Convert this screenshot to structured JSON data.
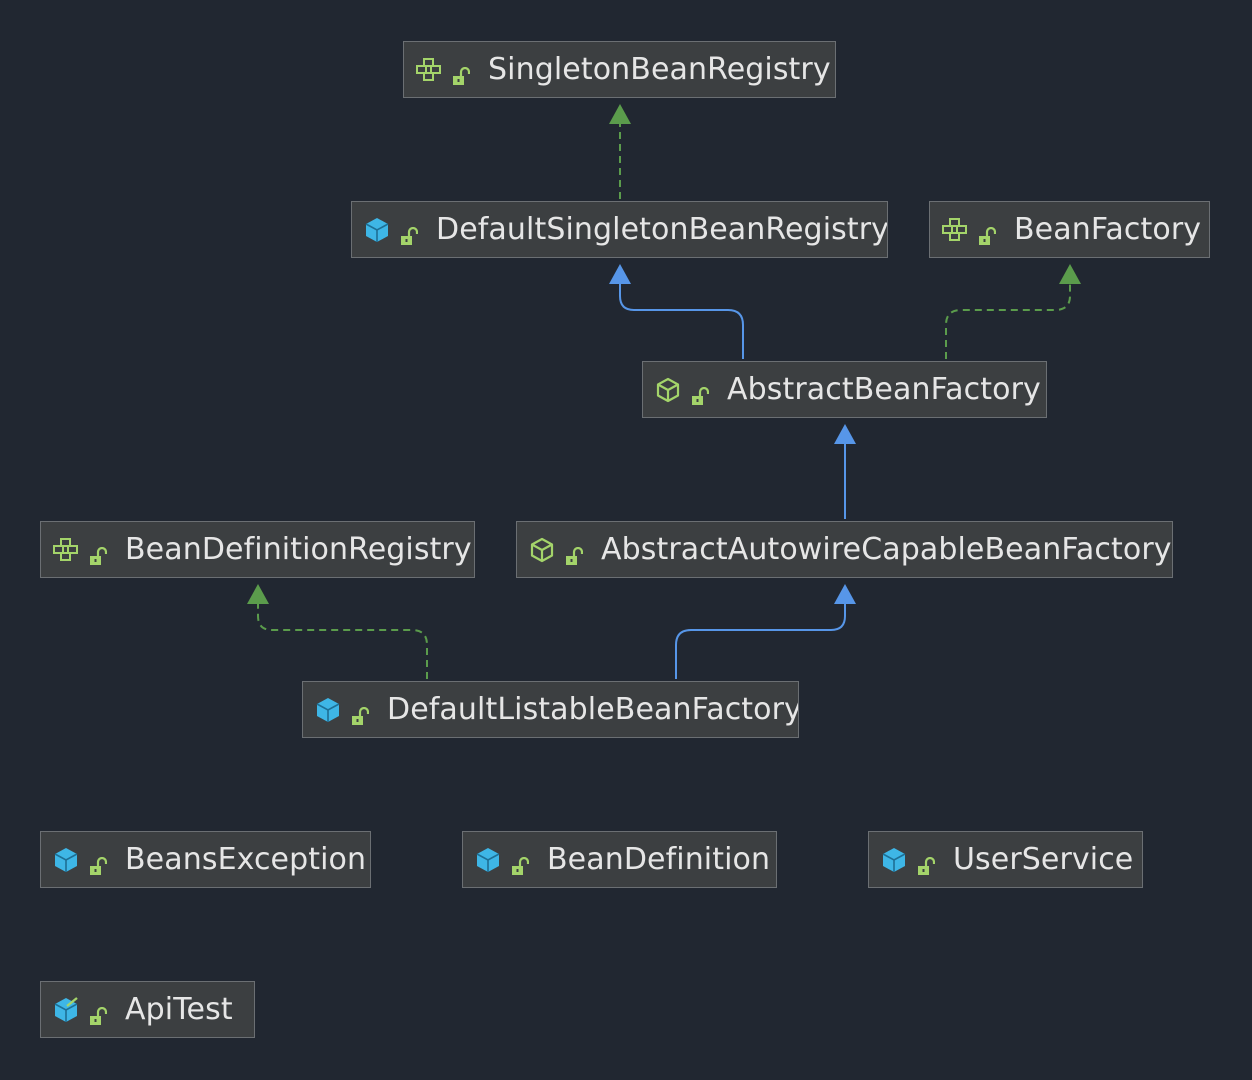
{
  "diagram": {
    "colors": {
      "background": "#212731",
      "node_fill": "#3c3f41",
      "node_border": "#6b6f73",
      "node_text": "#e6e6e6",
      "extends_arrow": "#5796e8",
      "implements_arrow": "#5b9c4c",
      "class_icon": "#3eb6e6",
      "abstract_interface_icon": "#a4d46a",
      "public_icon": "#a4d46a"
    },
    "nodes": [
      {
        "id": "SingletonBeanRegistry",
        "label": "SingletonBeanRegistry",
        "kind": "interface",
        "visibility": "public"
      },
      {
        "id": "DefaultSingletonBeanRegistry",
        "label": "DefaultSingletonBeanRegistry",
        "kind": "class",
        "visibility": "public"
      },
      {
        "id": "BeanFactory",
        "label": "BeanFactory",
        "kind": "interface",
        "visibility": "public"
      },
      {
        "id": "AbstractBeanFactory",
        "label": "AbstractBeanFactory",
        "kind": "abstract-class",
        "visibility": "public"
      },
      {
        "id": "BeanDefinitionRegistry",
        "label": "BeanDefinitionRegistry",
        "kind": "interface",
        "visibility": "public"
      },
      {
        "id": "AbstractAutowireCapableBeanFactory",
        "label": "AbstractAutowireCapableBeanFactory",
        "kind": "abstract-class",
        "visibility": "public"
      },
      {
        "id": "DefaultListableBeanFactory",
        "label": "DefaultListableBeanFactory",
        "kind": "class",
        "visibility": "public"
      },
      {
        "id": "BeansException",
        "label": "BeansException",
        "kind": "class",
        "visibility": "public"
      },
      {
        "id": "BeanDefinition",
        "label": "BeanDefinition",
        "kind": "class",
        "visibility": "public"
      },
      {
        "id": "UserService",
        "label": "UserService",
        "kind": "class",
        "visibility": "public"
      },
      {
        "id": "ApiTest",
        "label": "ApiTest",
        "kind": "test-class",
        "visibility": "public"
      }
    ],
    "edges": [
      {
        "from": "DefaultSingletonBeanRegistry",
        "to": "SingletonBeanRegistry",
        "type": "implements"
      },
      {
        "from": "AbstractBeanFactory",
        "to": "DefaultSingletonBeanRegistry",
        "type": "extends"
      },
      {
        "from": "AbstractBeanFactory",
        "to": "BeanFactory",
        "type": "implements"
      },
      {
        "from": "AbstractAutowireCapableBeanFactory",
        "to": "AbstractBeanFactory",
        "type": "extends"
      },
      {
        "from": "DefaultListableBeanFactory",
        "to": "AbstractAutowireCapableBeanFactory",
        "type": "extends"
      },
      {
        "from": "DefaultListableBeanFactory",
        "to": "BeanDefinitionRegistry",
        "type": "implements"
      }
    ]
  }
}
